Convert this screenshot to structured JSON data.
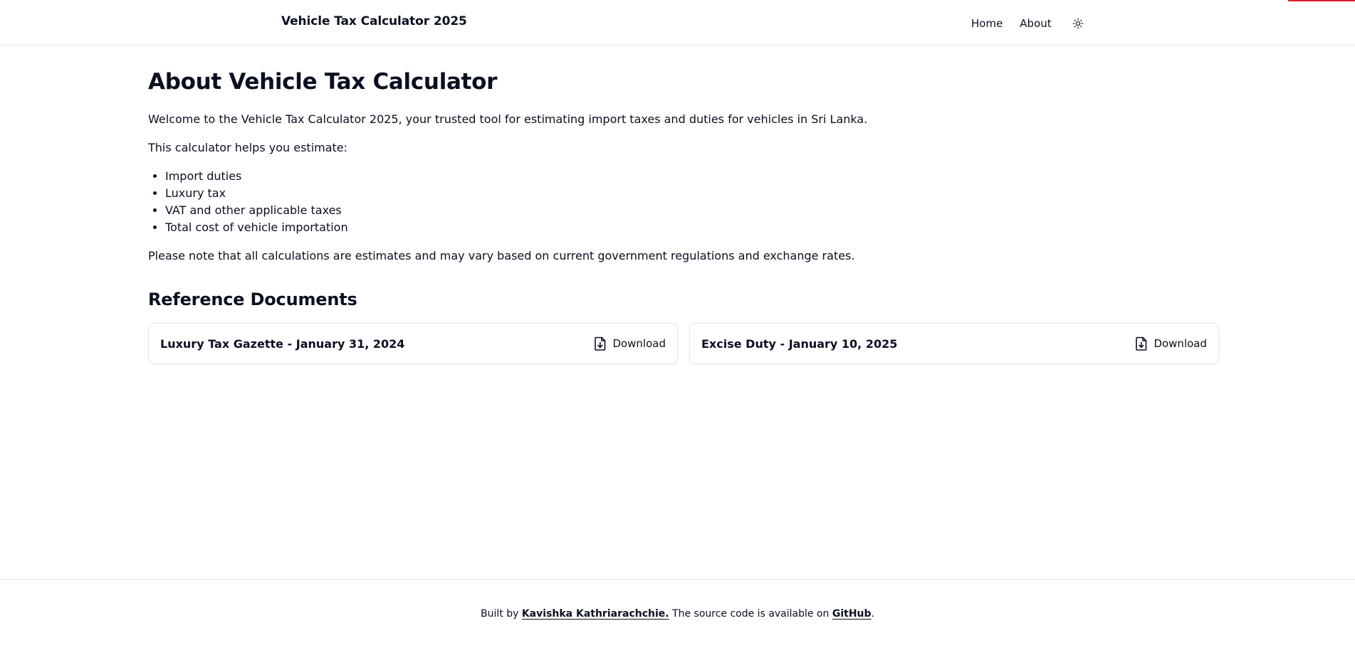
{
  "header": {
    "title": "Vehicle Tax Calculator 2025",
    "nav": {
      "home": "Home",
      "about": "About"
    },
    "theme_icon": "sun-icon",
    "accent_color": "#e11d2e"
  },
  "main": {
    "title": "About Vehicle Tax Calculator",
    "intro": "Welcome to the Vehicle Tax Calculator 2025, your trusted tool for estimating import taxes and duties for vehicles in Sri Lanka.",
    "helps": "This calculator helps you estimate:",
    "features": [
      "Import duties",
      "Luxury tax",
      "VAT and other applicable taxes",
      "Total cost of vehicle importation"
    ],
    "note": "Please note that all calculations are estimates and may vary based on current government regulations and exchange rates.",
    "reference_heading": "Reference Documents",
    "documents": [
      {
        "title": "Luxury Tax Gazette - January 31, 2024",
        "action": "Download",
        "icon": "file-download-icon"
      },
      {
        "title": "Excise Duty - January 10, 2025",
        "action": "Download",
        "icon": "file-download-icon"
      }
    ]
  },
  "footer": {
    "prefix": "Built by ",
    "author": "Kavishka Kathriarachchie.",
    "middle": " The source code is available on ",
    "repo": "GitHub",
    "suffix": "."
  }
}
